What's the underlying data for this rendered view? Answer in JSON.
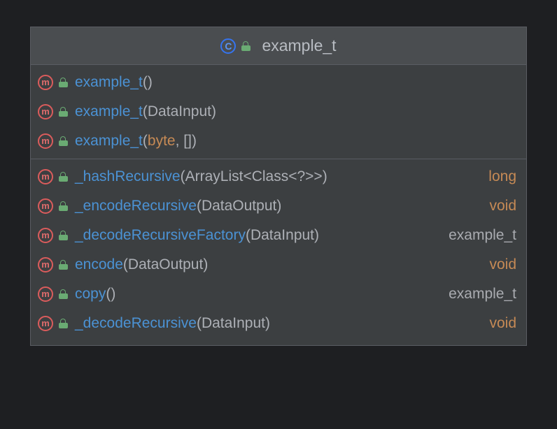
{
  "header": {
    "title": "example_t"
  },
  "constructors": [
    {
      "name": "example_t",
      "params": []
    },
    {
      "name": "example_t",
      "params": [
        {
          "text": "DataInput",
          "kind": "plain"
        }
      ]
    },
    {
      "name": "example_t",
      "params": [
        {
          "text": "byte",
          "kind": "kw"
        },
        {
          "text": "[]",
          "kind": "plain"
        }
      ]
    }
  ],
  "methods": [
    {
      "name": "_hashRecursive",
      "params": [
        {
          "text": "ArrayList<Class<?>>",
          "kind": "plain"
        }
      ],
      "ret": "long",
      "retKind": "kw"
    },
    {
      "name": "_encodeRecursive",
      "params": [
        {
          "text": "DataOutput",
          "kind": "plain"
        }
      ],
      "ret": "void",
      "retKind": "kw"
    },
    {
      "name": "_decodeRecursiveFactory",
      "params": [
        {
          "text": "DataInput",
          "kind": "plain"
        }
      ],
      "ret": "example_t",
      "retKind": "type"
    },
    {
      "name": "encode",
      "params": [
        {
          "text": "DataOutput",
          "kind": "plain"
        }
      ],
      "ret": "void",
      "retKind": "kw"
    },
    {
      "name": "copy",
      "params": [],
      "ret": "example_t",
      "retKind": "type"
    },
    {
      "name": "_decodeRecursive",
      "params": [
        {
          "text": "DataInput",
          "kind": "plain"
        }
      ],
      "ret": "void",
      "retKind": "kw"
    }
  ]
}
